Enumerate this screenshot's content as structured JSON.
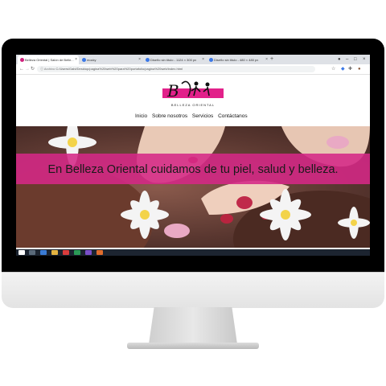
{
  "browser": {
    "tabs": [
      {
        "label": "Belleza Oriental | Salón de Belle...",
        "active": true
      },
      {
        "label": "mocky",
        "active": false
      },
      {
        "label": "Diseño sin título - 1124 × 300 px",
        "active": false
      },
      {
        "label": "Diseño sin título - 480 × 480 px",
        "active": false
      }
    ],
    "address": {
      "scheme_label": "Archivo",
      "url": "C:/Users/Gabi/Desktop/pagina%20web%20para%20portafolio/pagina%20web/index.html"
    }
  },
  "site": {
    "logo_tagline": "BELLEZA ORIENTAL",
    "nav": [
      "Inicio",
      "Sobre nosotros",
      "Servicios",
      "Contáctanos"
    ],
    "hero_text": "En Belleza Oriental cuidamos de tu piel, salud y belleza."
  },
  "colors": {
    "accent": "#d52886",
    "monitor": "#000000"
  },
  "icons": [
    "back-icon",
    "forward-icon",
    "reload-icon",
    "info-icon",
    "star-icon",
    "extension-icon",
    "profile-icon",
    "new-tab-icon"
  ]
}
